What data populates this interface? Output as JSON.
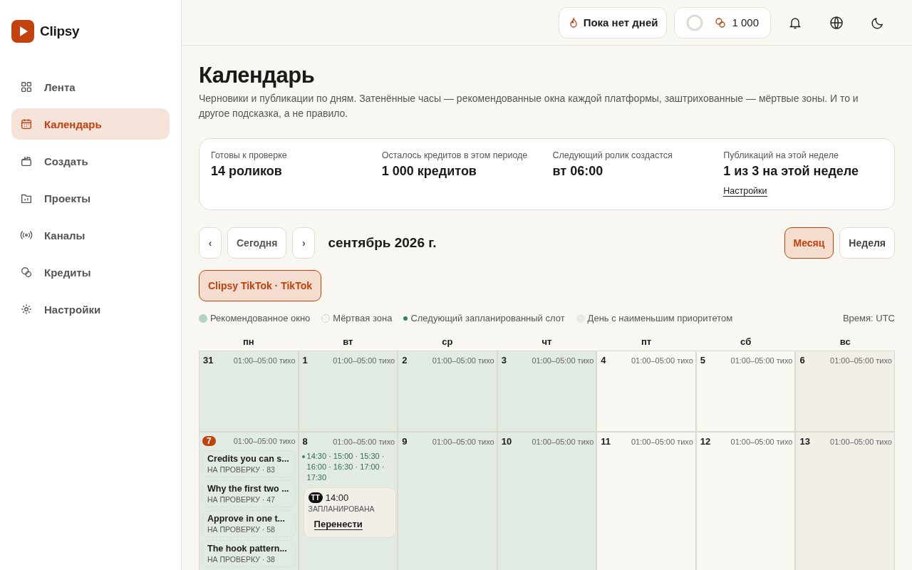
{
  "brand": {
    "name": "Clipsy"
  },
  "sidebar": {
    "items": [
      {
        "label": "Лента",
        "selected": false
      },
      {
        "label": "Календарь",
        "selected": true
      },
      {
        "label": "Создать",
        "selected": false
      },
      {
        "label": "Проекты",
        "selected": false
      },
      {
        "label": "Каналы",
        "selected": false
      },
      {
        "label": "Кредиты",
        "selected": false
      },
      {
        "label": "Настройки",
        "selected": false
      }
    ]
  },
  "topbar": {
    "streak": "Пока нет дней",
    "credits": "1 000"
  },
  "page": {
    "title": "Календарь",
    "subtitle": "Черновики и публикации по дням. Затенённые часы — рекомендованные окна каждой платформы, заштрихованные — мёртвые зоны. И то и другое подсказка, а не правило."
  },
  "stats": [
    {
      "label": "Готовы к проверке",
      "value": "14 роликов"
    },
    {
      "label": "Осталось кредитов в этом периоде",
      "value": "1 000 кредитов"
    },
    {
      "label": "Следующий ролик создастся",
      "value": "вт 06:00"
    },
    {
      "label": "Публикаций на этой неделе",
      "value": "1 из 3 на этой неделе",
      "link": "Настройки"
    }
  ],
  "nav": {
    "prev": "‹",
    "today": "Сегодня",
    "next": "›",
    "period": "сентябрь 2026 г."
  },
  "views": [
    {
      "label": "Месяц",
      "selected": true
    },
    {
      "label": "Неделя",
      "selected": false
    }
  ],
  "channels": [
    {
      "label": "Clipsy TikTok · TikTok",
      "selected": true
    }
  ],
  "legend": [
    {
      "kind": "recommended",
      "label": "Рекомендованное окно"
    },
    {
      "kind": "dead",
      "label": "Мёртвая зона"
    },
    {
      "kind": "next",
      "label": "Следующий запланированный слот"
    },
    {
      "kind": "low",
      "label": "День с наименьшим приоритетом"
    }
  ],
  "timezone": "Время: UTC",
  "weekdays": [
    "пн",
    "вт",
    "ср",
    "чт",
    "пт",
    "сб",
    "вс"
  ],
  "weeks": [
    {
      "days": [
        {
          "day": "31",
          "quiet": "01:00–05:00 тихо",
          "kind": "recommended",
          "today": false
        },
        {
          "day": "1",
          "quiet": "01:00–05:00 тихо",
          "kind": "recommended",
          "today": false
        },
        {
          "day": "2",
          "quiet": "01:00–05:00 тихо",
          "kind": "recommended",
          "today": false
        },
        {
          "day": "3",
          "quiet": "01:00–05:00 тихо",
          "kind": "recommended",
          "today": false
        },
        {
          "day": "4",
          "quiet": "01:00–05:00 тихо",
          "kind": "plain",
          "today": false
        },
        {
          "day": "5",
          "quiet": "01:00–05:00 тихо",
          "kind": "plain",
          "today": false
        },
        {
          "day": "6",
          "quiet": "01:00–05:00 тихо",
          "kind": "low",
          "today": false
        }
      ]
    },
    {
      "days": [
        {
          "day": "7",
          "quiet": "01:00–05:00 тихо",
          "kind": "recommended",
          "today": true,
          "drafts": [
            {
              "title": "Credits you can s...",
              "meta": "НА ПРОВЕРКУ · 83"
            },
            {
              "title": "Why the first two ...",
              "meta": "НА ПРОВЕРКУ · 47"
            },
            {
              "title": "Approve in one t...",
              "meta": "НА ПРОВЕРКУ · 58"
            },
            {
              "title": "The hook pattern...",
              "meta": "НА ПРОВЕРКУ · 38"
            }
          ]
        },
        {
          "day": "8",
          "quiet": "01:00–05:00 тихо",
          "kind": "recommended",
          "today": false,
          "slots": "14:30 · 15:00 · 15:30 · 16:00 · 16:30 · 17:00 · 17:30",
          "posts": [
            {
              "badge": "TT",
              "time": "14:00",
              "status": "ЗАПЛАНИРОВАНА",
              "action": "Перенести"
            }
          ]
        },
        {
          "day": "9",
          "quiet": "01:00–05:00 тихо",
          "kind": "recommended",
          "today": false
        },
        {
          "day": "10",
          "quiet": "01:00–05:00 тихо",
          "kind": "recommended",
          "today": false
        },
        {
          "day": "11",
          "quiet": "01:00–05:00 тихо",
          "kind": "plain",
          "today": false
        },
        {
          "day": "12",
          "quiet": "01:00–05:00 тихо",
          "kind": "plain",
          "today": false
        },
        {
          "day": "13",
          "quiet": "01:00–05:00 тихо",
          "kind": "low",
          "today": false
        }
      ]
    }
  ]
}
